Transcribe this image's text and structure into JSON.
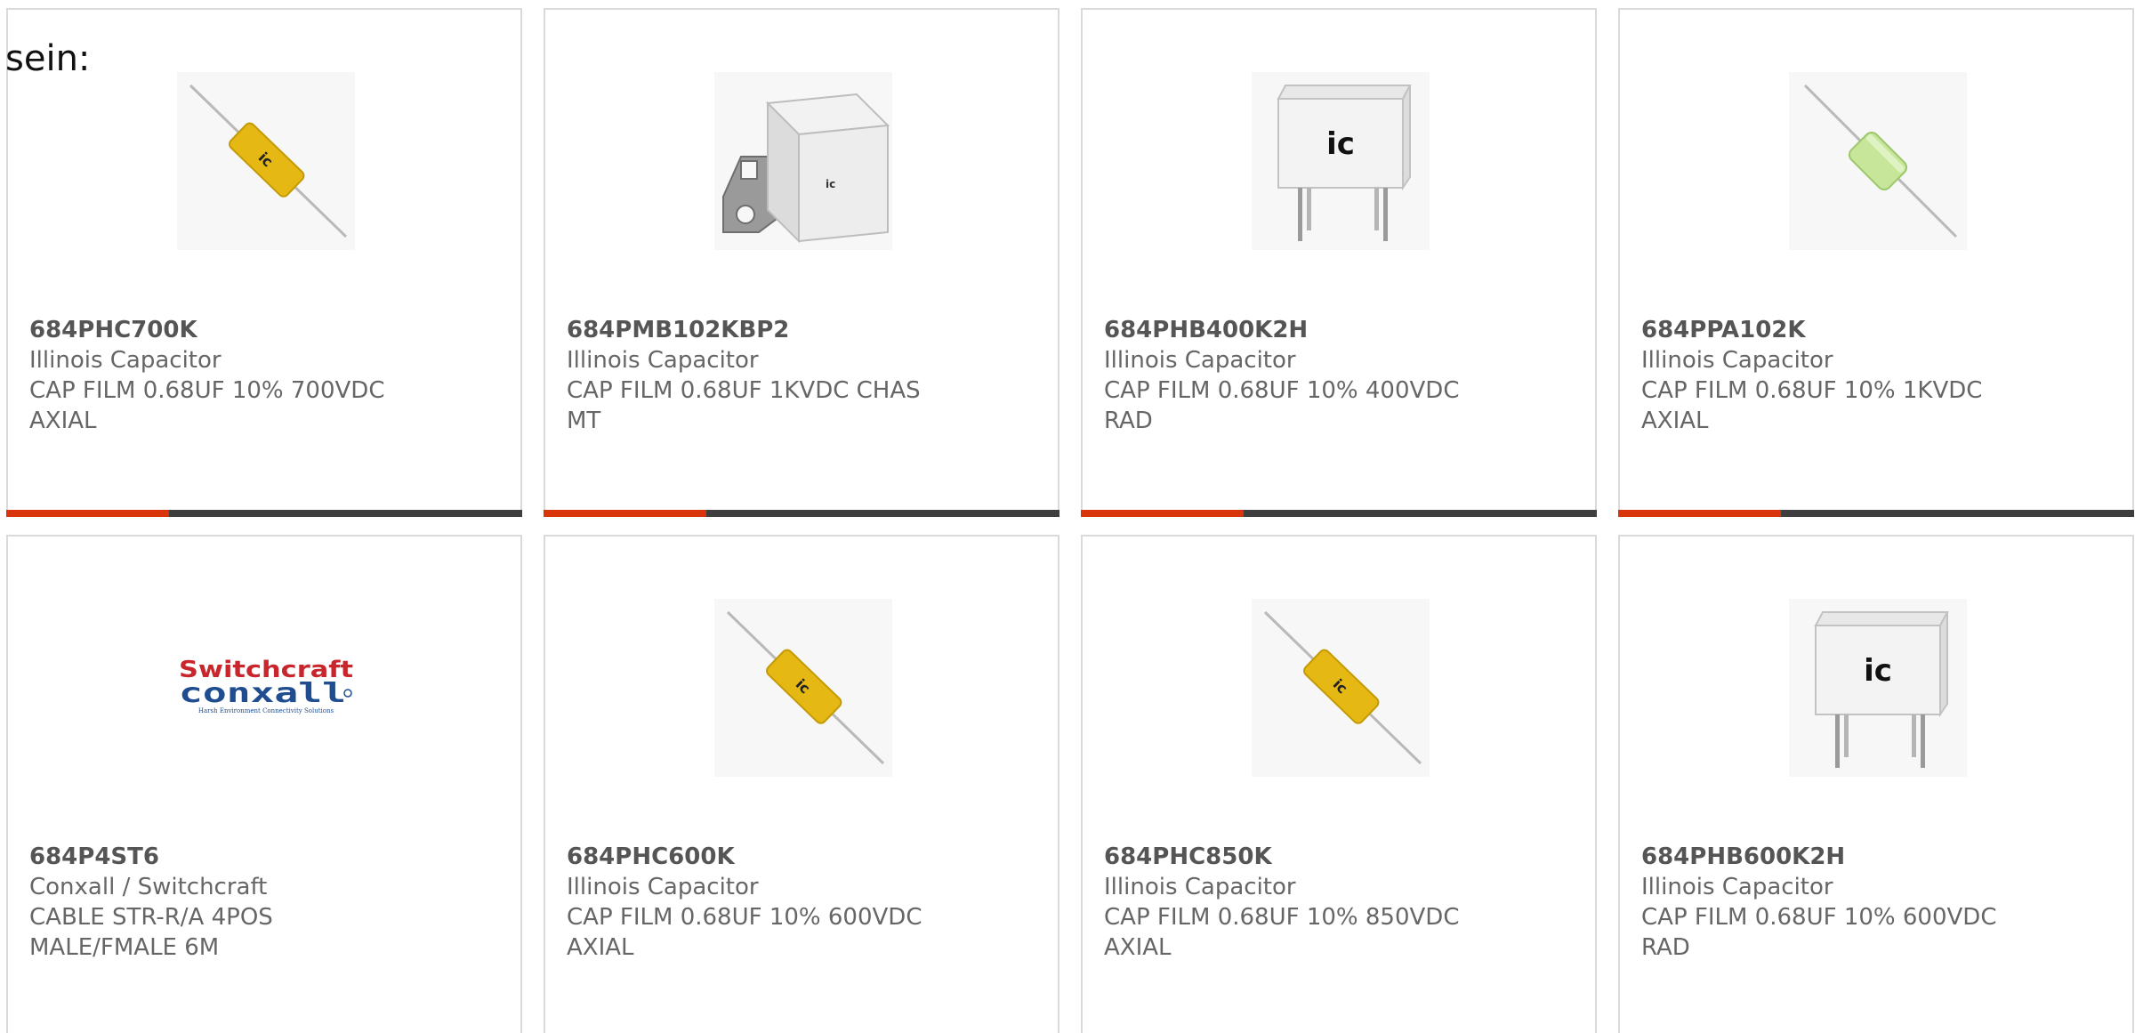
{
  "intro_text": "sein:",
  "products": [
    {
      "part_number": "684PHC700K",
      "manufacturer": "Illinois Capacitor",
      "description": "CAP FILM 0.68UF 10% 700VDC\nAXIAL",
      "image": "axial-yellow-capacitor-icon"
    },
    {
      "part_number": "684PMB102KBP2",
      "manufacturer": "Illinois Capacitor",
      "description": "CAP FILM 0.68UF 1KVDC CHAS\nMT",
      "image": "chassis-mount-capacitor-icon"
    },
    {
      "part_number": "684PHB400K2H",
      "manufacturer": "Illinois Capacitor",
      "description": "CAP FILM 0.68UF 10% 400VDC\nRAD",
      "image": "radial-box-capacitor-icon"
    },
    {
      "part_number": "684PPA102K",
      "manufacturer": "Illinois Capacitor",
      "description": "CAP FILM 0.68UF 10% 1KVDC\nAXIAL",
      "image": "axial-green-capacitor-icon"
    },
    {
      "part_number": "684P4ST6",
      "manufacturer": "Conxall / Switchcraft",
      "description": "CABLE STR-R/A 4POS\nMALE/FMALE 6M",
      "image": "switchcraft-conxall-logo",
      "logo_line1": "Switchcraft",
      "logo_line2": "conxall",
      "logo_tagline": "Harsh Environment Connectivity Solutions"
    },
    {
      "part_number": "684PHC600K",
      "manufacturer": "Illinois Capacitor",
      "description": "CAP FILM 0.68UF 10% 600VDC\nAXIAL",
      "image": "axial-yellow-capacitor-icon"
    },
    {
      "part_number": "684PHC850K",
      "manufacturer": "Illinois Capacitor",
      "description": "CAP FILM 0.68UF 10% 850VDC\nAXIAL",
      "image": "axial-yellow-capacitor-icon"
    },
    {
      "part_number": "684PHB600K2H",
      "manufacturer": "Illinois Capacitor",
      "description": "CAP FILM 0.68UF 10% 600VDC\nRAD",
      "image": "radial-box-capacitor-icon"
    }
  ],
  "colors": {
    "accent": "#d8350a",
    "bar": "#3e3e3e",
    "border": "#dadada",
    "part_number_text": "#555555",
    "body_text": "#666666"
  }
}
